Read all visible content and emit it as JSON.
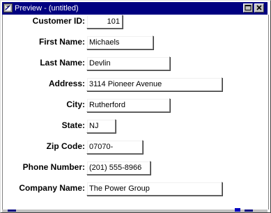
{
  "window": {
    "title": "Preview - (untitled)"
  },
  "form": {
    "customer_id": {
      "label": "Customer ID:",
      "value": "101"
    },
    "first_name": {
      "label": "First Name:",
      "value": "Michaels"
    },
    "last_name": {
      "label": "Last Name:",
      "value": "Devlin"
    },
    "address": {
      "label": "Address:",
      "value": "3114 Pioneer Avenue"
    },
    "city": {
      "label": "City:",
      "value": "Rutherford"
    },
    "state": {
      "label": "State:",
      "value": "NJ"
    },
    "zip_code": {
      "label": "Zip Code:",
      "value": "07070-"
    },
    "phone_number": {
      "label": "Phone Number:",
      "value": "(201) 555-8966"
    },
    "company_name": {
      "label": "Company Name:",
      "value": "The Power Group"
    }
  },
  "icons": {
    "system": "window-app-icon",
    "maximize": "maximize-icon",
    "close": "close-icon"
  },
  "colors": {
    "titlebar": "#000080",
    "title_text": "#ffffff",
    "background": "#ffffff",
    "chrome": "#c0c0c0"
  }
}
